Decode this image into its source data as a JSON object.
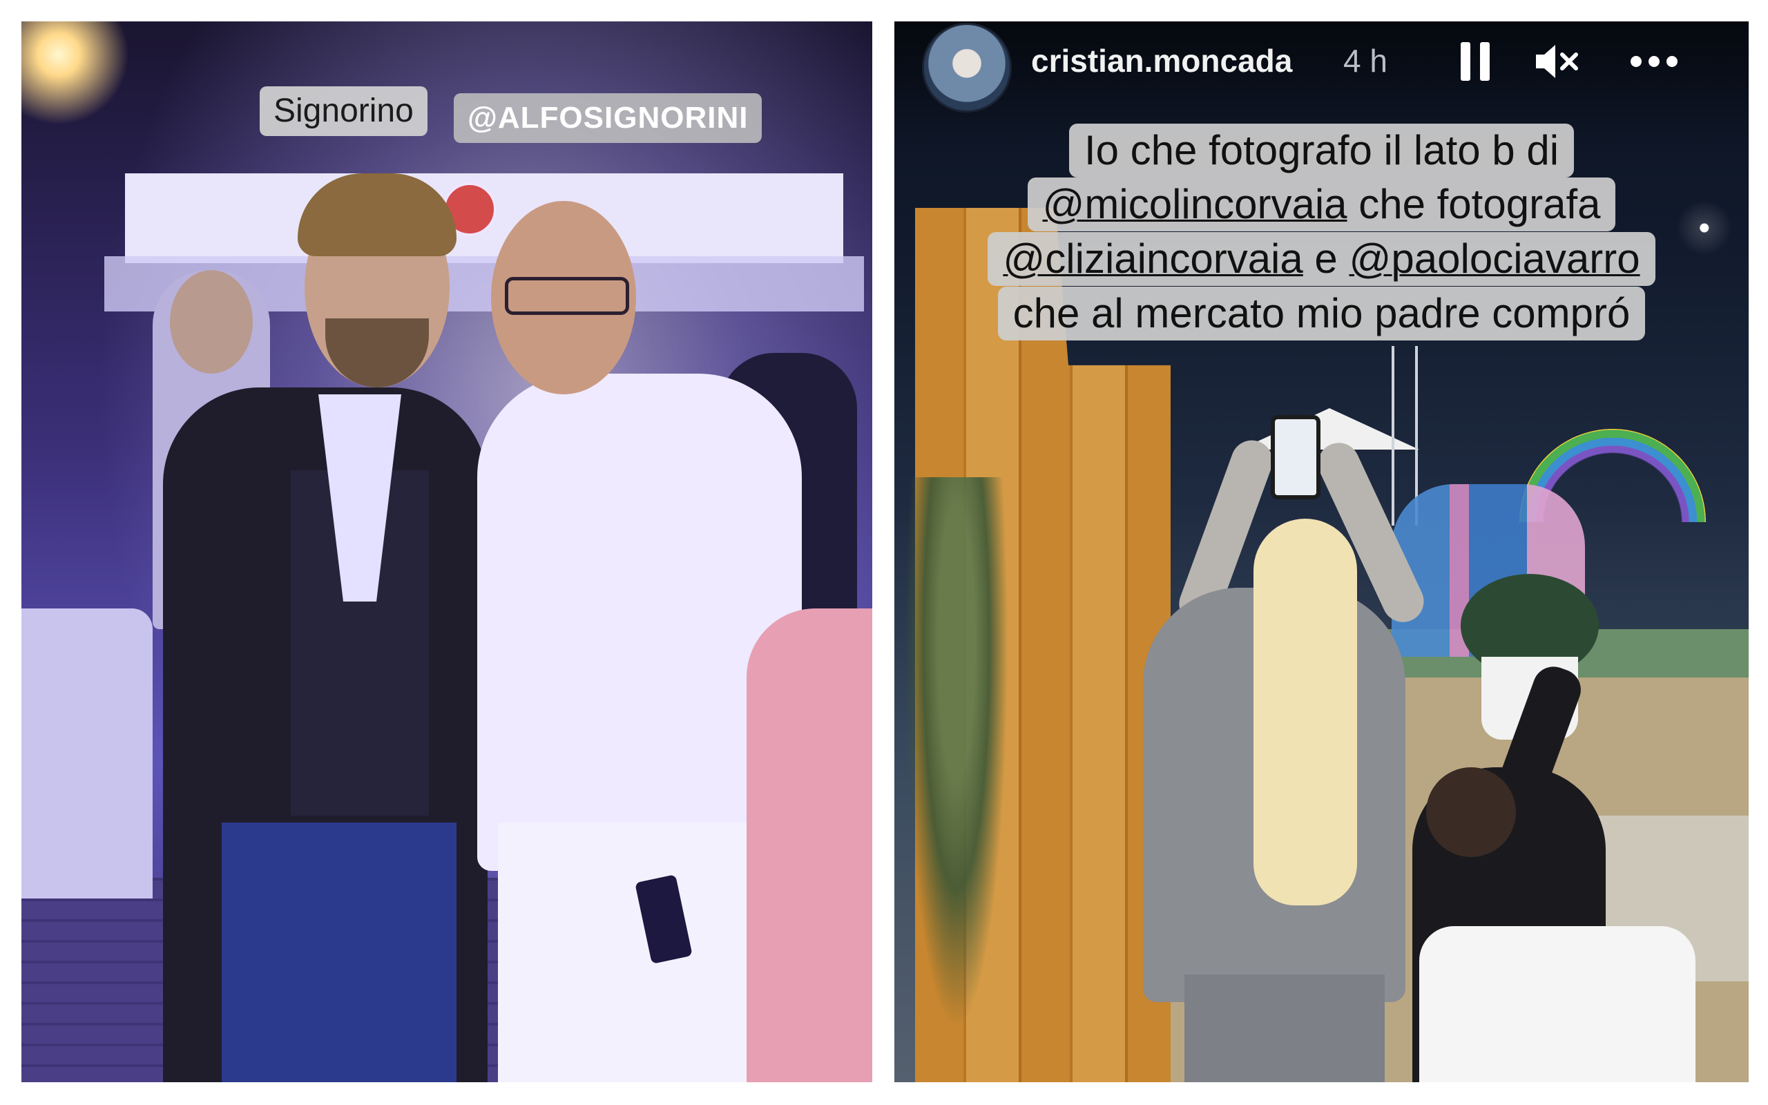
{
  "left_story": {
    "tag_name": "Signorino",
    "tag_mention": "@ALFOSIGNORINI"
  },
  "right_story": {
    "header": {
      "username": "cristian.moncada",
      "time_ago": "4 h",
      "pause_icon": "pause-icon",
      "mute_icon": "speaker-muted-icon",
      "more_icon": "more-horizontal-icon"
    },
    "caption": {
      "line1": "Io che fotografo il lato b di",
      "line2_mention": "@micolincorvaia",
      "line2_rest": " che fotografa",
      "line3_mention1": "@cliziaincorvaia",
      "line3_mid": " e ",
      "line3_mention2": "@paolociavarro",
      "line4": "che al mercato mio padre compró"
    }
  },
  "colors": {
    "page_background": "#ffffff",
    "caption_background": "#cdcdcd",
    "header_text": "#f1f1f1"
  }
}
